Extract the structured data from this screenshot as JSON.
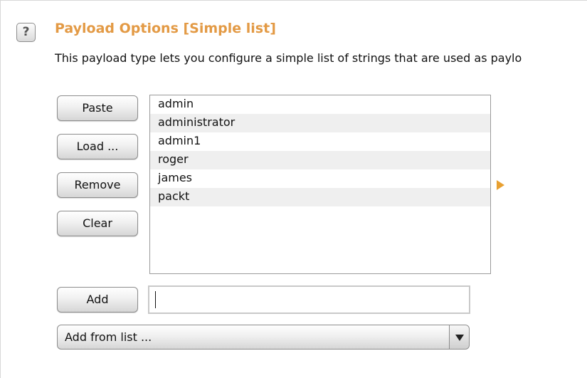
{
  "header": {
    "help_icon_glyph": "?",
    "title": "Payload Options [Simple list]",
    "title_color": "#e39a45",
    "description": "This payload type lets you configure a simple list of strings that are used as paylo"
  },
  "buttons": {
    "paste": "Paste",
    "load": "Load ...",
    "remove": "Remove",
    "clear": "Clear",
    "add": "Add"
  },
  "list": {
    "items": [
      "admin",
      "administrator",
      "admin1",
      "roger",
      "james",
      "packt"
    ]
  },
  "add_input": {
    "value": ""
  },
  "add_from_list": {
    "selected": "Add from list ..."
  },
  "icons": {
    "help": "help-question-icon",
    "marker": "expand-arrow-icon",
    "dropdown": "chevron-down-icon"
  },
  "colors": {
    "accent": "#e39a45",
    "arrow": "#e8a031"
  }
}
